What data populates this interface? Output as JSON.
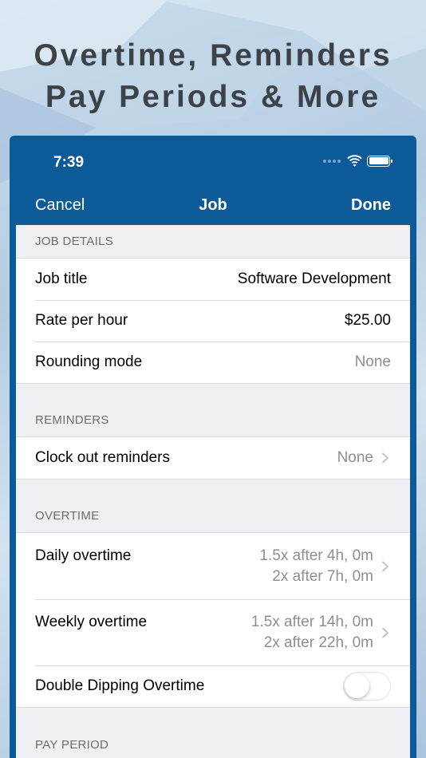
{
  "promo": {
    "headline_line1": "Overtime, Reminders",
    "headline_line2": "Pay Periods & More"
  },
  "status_bar": {
    "time": "7:39"
  },
  "nav": {
    "cancel_label": "Cancel",
    "title": "Job",
    "done_label": "Done"
  },
  "sections": {
    "job_details": {
      "header": "JOB DETAILS",
      "job_title": {
        "label": "Job title",
        "value": "Software Development"
      },
      "rate_per_hour": {
        "label": "Rate per hour",
        "value": "$25.00"
      },
      "rounding_mode": {
        "label": "Rounding mode",
        "value": "None"
      }
    },
    "reminders": {
      "header": "REMINDERS",
      "clock_out": {
        "label": "Clock out reminders",
        "value": "None"
      }
    },
    "overtime": {
      "header": "OVERTIME",
      "daily": {
        "label": "Daily overtime",
        "line1": "1.5x after 4h, 0m",
        "line2": "2x after 7h, 0m"
      },
      "weekly": {
        "label": "Weekly overtime",
        "line1": "1.5x after 14h, 0m",
        "line2": "2x after 22h, 0m"
      },
      "double_dipping": {
        "label": "Double Dipping Overtime",
        "enabled": false
      }
    },
    "pay_period": {
      "header": "PAY PERIOD"
    }
  },
  "colors": {
    "nav_background": "#0c5a98",
    "headline_text": "#3d4249",
    "muted_value": "#8e8e93",
    "section_header_text": "#6d6d72",
    "grouped_background": "#efeff4"
  },
  "icons": {
    "wifi": "wifi-icon",
    "battery": "battery-icon",
    "signal": "signal-icon",
    "chevron": "chevron-right-icon"
  }
}
